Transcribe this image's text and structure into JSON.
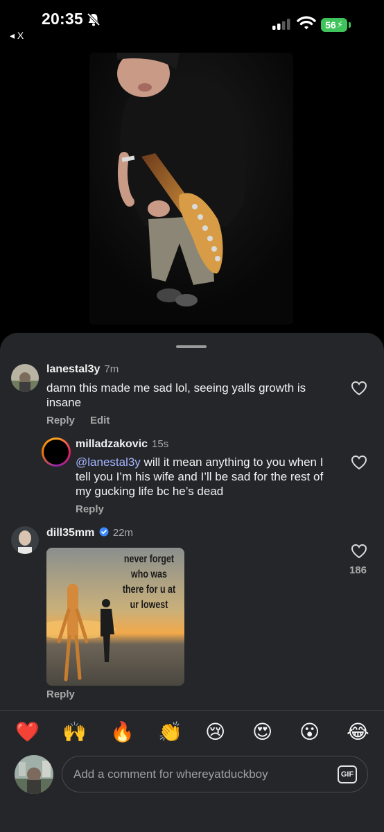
{
  "status_bar": {
    "time": "20:35",
    "battery": "56",
    "back_label": "◂ X"
  },
  "comments": [
    {
      "username": "lanestal3y",
      "time_ago": "7m",
      "text": "damn this made me sad lol, seeing yalls growth is insane",
      "reply_label": "Reply",
      "edit_label": "Edit"
    },
    {
      "username": "milladzakovic",
      "time_ago": "15s",
      "mention": "@lanestal3y",
      "text": " will it mean anything to you when I tell you I’m his wife and I’ll be sad for the rest of my gucking life bc he’s dead",
      "reply_label": "Reply"
    },
    {
      "username": "dill35mm",
      "verified": true,
      "time_ago": "22m",
      "meme_text": "never forget who was there for u at ur lowest",
      "reply_label": "Reply",
      "likes": "186"
    }
  ],
  "reactions": [
    "❤️",
    "🙌",
    "🔥",
    "👏",
    "😢",
    "😍",
    "😮",
    "😂"
  ],
  "composer": {
    "placeholder": "Add a comment for whereyatduckboy",
    "gif_label": "GIF"
  },
  "colors": {
    "sheet_bg": "#25262a",
    "mention": "#a4b4ff",
    "battery": "#3ec45a",
    "verified": "#3b8bff"
  },
  "icons": [
    "bell-slash-icon",
    "signal-icon",
    "wifi-icon",
    "battery-icon",
    "heart-icon",
    "verified-badge-icon",
    "gif-icon"
  ]
}
